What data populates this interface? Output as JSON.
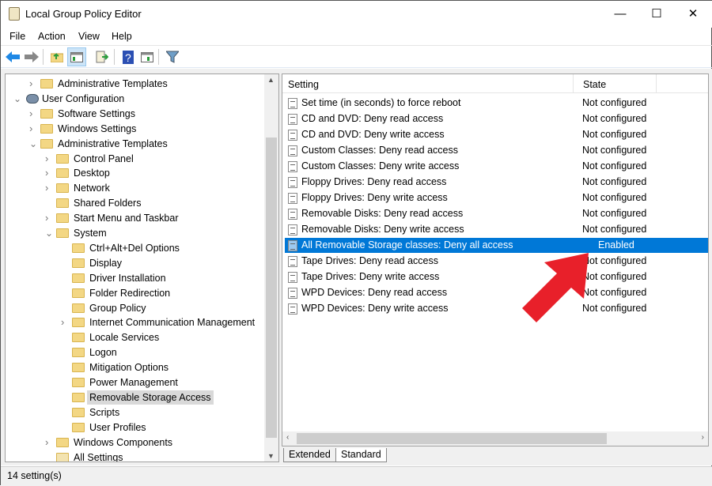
{
  "window": {
    "title": "Local Group Policy Editor",
    "minimize": "—",
    "maximize": "☐",
    "close": "✕"
  },
  "menu": [
    "File",
    "Action",
    "View",
    "Help"
  ],
  "toolbar": [
    {
      "icon": "back-arrow-icon",
      "color": "#1e88e5"
    },
    {
      "icon": "forward-arrow-icon",
      "color": "#888888"
    },
    {
      "icon": "up-folder-icon"
    },
    {
      "icon": "show-hide-console-tree-icon",
      "active": true
    },
    {
      "icon": "export-list-icon"
    },
    {
      "icon": "help-icon",
      "color": "#2b4fb3"
    },
    {
      "icon": "show-action-pane-icon"
    },
    {
      "icon": "filter-icon"
    }
  ],
  "tree": [
    {
      "label": "Administrative Templates",
      "level": 1,
      "chevron": ">",
      "icon": "folder"
    },
    {
      "label": "User Configuration",
      "level": 0,
      "chevron": "v",
      "icon": "user-config"
    },
    {
      "label": "Software Settings",
      "level": 1,
      "chevron": ">",
      "icon": "folder"
    },
    {
      "label": "Windows Settings",
      "level": 1,
      "chevron": ">",
      "icon": "folder"
    },
    {
      "label": "Administrative Templates",
      "level": 1,
      "chevron": "v",
      "icon": "folder"
    },
    {
      "label": "Control Panel",
      "level": 2,
      "chevron": ">",
      "icon": "folder"
    },
    {
      "label": "Desktop",
      "level": 2,
      "chevron": ">",
      "icon": "folder"
    },
    {
      "label": "Network",
      "level": 2,
      "chevron": ">",
      "icon": "folder"
    },
    {
      "label": "Shared Folders",
      "level": 2,
      "chevron": "",
      "icon": "folder"
    },
    {
      "label": "Start Menu and Taskbar",
      "level": 2,
      "chevron": ">",
      "icon": "folder"
    },
    {
      "label": "System",
      "level": 2,
      "chevron": "v",
      "icon": "folder"
    },
    {
      "label": "Ctrl+Alt+Del Options",
      "level": 3,
      "chevron": "",
      "icon": "folder"
    },
    {
      "label": "Display",
      "level": 3,
      "chevron": "",
      "icon": "folder"
    },
    {
      "label": "Driver Installation",
      "level": 3,
      "chevron": "",
      "icon": "folder"
    },
    {
      "label": "Folder Redirection",
      "level": 3,
      "chevron": "",
      "icon": "folder"
    },
    {
      "label": "Group Policy",
      "level": 3,
      "chevron": "",
      "icon": "folder"
    },
    {
      "label": "Internet Communication Management",
      "level": 3,
      "chevron": ">",
      "icon": "folder"
    },
    {
      "label": "Locale Services",
      "level": 3,
      "chevron": "",
      "icon": "folder"
    },
    {
      "label": "Logon",
      "level": 3,
      "chevron": "",
      "icon": "folder"
    },
    {
      "label": "Mitigation Options",
      "level": 3,
      "chevron": "",
      "icon": "folder"
    },
    {
      "label": "Power Management",
      "level": 3,
      "chevron": "",
      "icon": "folder"
    },
    {
      "label": "Removable Storage Access",
      "level": 3,
      "chevron": "",
      "icon": "folder",
      "selected": true
    },
    {
      "label": "Scripts",
      "level": 3,
      "chevron": "",
      "icon": "folder"
    },
    {
      "label": "User Profiles",
      "level": 3,
      "chevron": "",
      "icon": "folder"
    },
    {
      "label": "Windows Components",
      "level": 2,
      "chevron": ">",
      "icon": "folder"
    },
    {
      "label": "All Settings",
      "level": 2,
      "chevron": "",
      "icon": "all-settings"
    }
  ],
  "list": {
    "columns": [
      "Setting",
      "State"
    ],
    "rows": [
      {
        "setting": "Set time (in seconds) to force reboot",
        "state": "Not configured"
      },
      {
        "setting": "CD and DVD: Deny read access",
        "state": "Not configured"
      },
      {
        "setting": "CD and DVD: Deny write access",
        "state": "Not configured"
      },
      {
        "setting": "Custom Classes: Deny read access",
        "state": "Not configured"
      },
      {
        "setting": "Custom Classes: Deny write access",
        "state": "Not configured"
      },
      {
        "setting": "Floppy Drives: Deny read access",
        "state": "Not configured"
      },
      {
        "setting": "Floppy Drives: Deny write access",
        "state": "Not configured"
      },
      {
        "setting": "Removable Disks: Deny read access",
        "state": "Not configured"
      },
      {
        "setting": "Removable Disks: Deny write access",
        "state": "Not configured"
      },
      {
        "setting": "All Removable Storage classes: Deny all access",
        "state": "Enabled",
        "selected": true
      },
      {
        "setting": "Tape Drives: Deny read access",
        "state": "Not configured"
      },
      {
        "setting": "Tape Drives: Deny write access",
        "state": "Not configured"
      },
      {
        "setting": "WPD Devices: Deny read access",
        "state": "Not configured"
      },
      {
        "setting": "WPD Devices: Deny write access",
        "state": "Not configured"
      }
    ]
  },
  "tabs": [
    "Extended",
    "Standard"
  ],
  "active_tab": "Standard",
  "status": "14 setting(s)",
  "colors": {
    "selection": "#0078d7",
    "annotation_arrow": "#e8202a"
  }
}
